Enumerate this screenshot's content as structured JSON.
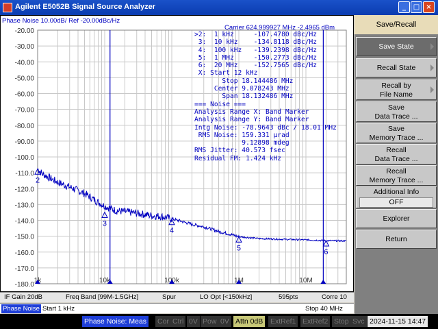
{
  "window": {
    "title": "Agilent E5052B Signal Source Analyzer"
  },
  "trace": {
    "title": "Phase Noise 10.00dB/ Ref -20.00dBc/Hz"
  },
  "axis": {
    "y_ticks": [
      "-20.00",
      "-30.00",
      "-40.00",
      "-50.00",
      "-60.00",
      "-70.00",
      "-80.00",
      "-90.00",
      "-100.0",
      "-110.0",
      "-120.0",
      "-130.0",
      "-140.0",
      "-150.0",
      "-160.0",
      "-170.0",
      "-180.0"
    ],
    "x_ticks": [
      "1k",
      "10k",
      "100k",
      "1M",
      "10M"
    ]
  },
  "carrier": "Carrier 624.999927 MHz    -2.4965 dBm",
  "marker_lines": [
    ">2:  1 kHz     -107.4780 dBc/Hz",
    " 3:  10 kHz    -134.8118 dBc/Hz",
    " 4:  100 kHz   -139.2398 dBc/Hz",
    " 5:  1 MHz     -150.2773 dBc/Hz",
    " 6:  20 MHz    -152.7565 dBc/Hz",
    " X: Start 12 kHz",
    "       Stop 18.144486 MHz",
    "     Center 9.078243 MHz",
    "       Span 18.132486 MHz",
    "=== Noise ===",
    "Analysis Range X: Band Marker",
    "Analysis Range Y: Band Marker",
    "Intg Noise: -78.9643 dBc / 18.01 MHz",
    " RMS Noise: 159.331 µrad",
    "            9.12898 mdeg",
    "RMS Jitter: 40.573 fsec",
    "Residual FM: 1.424 kHz"
  ],
  "markers": [
    {
      "label": "2",
      "freq_hz": 1000,
      "dbc": -107.478
    },
    {
      "label": "3",
      "freq_hz": 10000,
      "dbc": -134.8118
    },
    {
      "label": "4",
      "freq_hz": 100000,
      "dbc": -139.2398
    },
    {
      "label": "5",
      "freq_hz": 1000000,
      "dbc": -150.2773
    },
    {
      "label": "6",
      "freq_hz": 20000000,
      "dbc": -152.7565
    }
  ],
  "band_marker": {
    "start_hz": 12000,
    "stop_hz": 18144486
  },
  "chart_data": {
    "type": "line",
    "xscale": "log",
    "xlim": [
      1000,
      40000000
    ],
    "ylim": [
      -180,
      -20
    ],
    "series": [
      {
        "values_x": [
          1000,
          1200,
          1500,
          2000,
          3000,
          5000,
          7000,
          10000,
          15000,
          20000,
          30000,
          50000,
          70000,
          100000,
          150000,
          200000,
          300000,
          500000,
          700000,
          1000000,
          2000000,
          5000000,
          10000000,
          20000000,
          40000000
        ],
        "values_y": [
          -107.5,
          -111,
          -113,
          -116,
          -119,
          -123,
          -127,
          -131,
          -134,
          -134.5,
          -135.5,
          -137,
          -137.5,
          -139,
          -141,
          -142.5,
          -144,
          -147,
          -148.5,
          -150.3,
          -151.5,
          -152,
          -152.3,
          -152.8,
          -153
        ]
      }
    ]
  },
  "status_row1": [
    "IF Gain 20dB",
    "Freq Band [99M-1.5GHz]",
    "Spur",
    "LO Opt [<150kHz]",
    "595pts",
    "Corre 10"
  ],
  "status_row2": {
    "active": "Phase Noise",
    "start": "Start 1 kHz",
    "stop": "Stop 40 MHz"
  },
  "bottom_bar": {
    "meas": "Phase Noise: Meas",
    "items": [
      "Cor",
      "Ctrl",
      "0V",
      "Pow",
      "0V"
    ],
    "attn": "Attn 0dB",
    "items2": [
      "ExtRef1",
      "ExtRef2",
      "Stop",
      "Svc"
    ],
    "time": "2024-11-15 14:47"
  },
  "softkeys": {
    "header": "Save/Recall",
    "save_state": "Save State",
    "recall_state": "Recall State",
    "recall_by_file_1": "Recall by",
    "recall_by_file_2": "File Name",
    "save_data_1": "Save",
    "save_data_2": "Data Trace ...",
    "save_mem_1": "Save",
    "save_mem_2": "Memory Trace ...",
    "recall_data_1": "Recall",
    "recall_data_2": "Data Trace ...",
    "recall_mem_1": "Recall",
    "recall_mem_2": "Memory Trace ...",
    "addinfo": "Additional Info",
    "addinfo_val": "OFF",
    "explorer": "Explorer",
    "return": "Return"
  },
  "colors": {
    "trace": "#0000c0",
    "grid": "#c8c8c8",
    "marker": "#0000c0"
  }
}
